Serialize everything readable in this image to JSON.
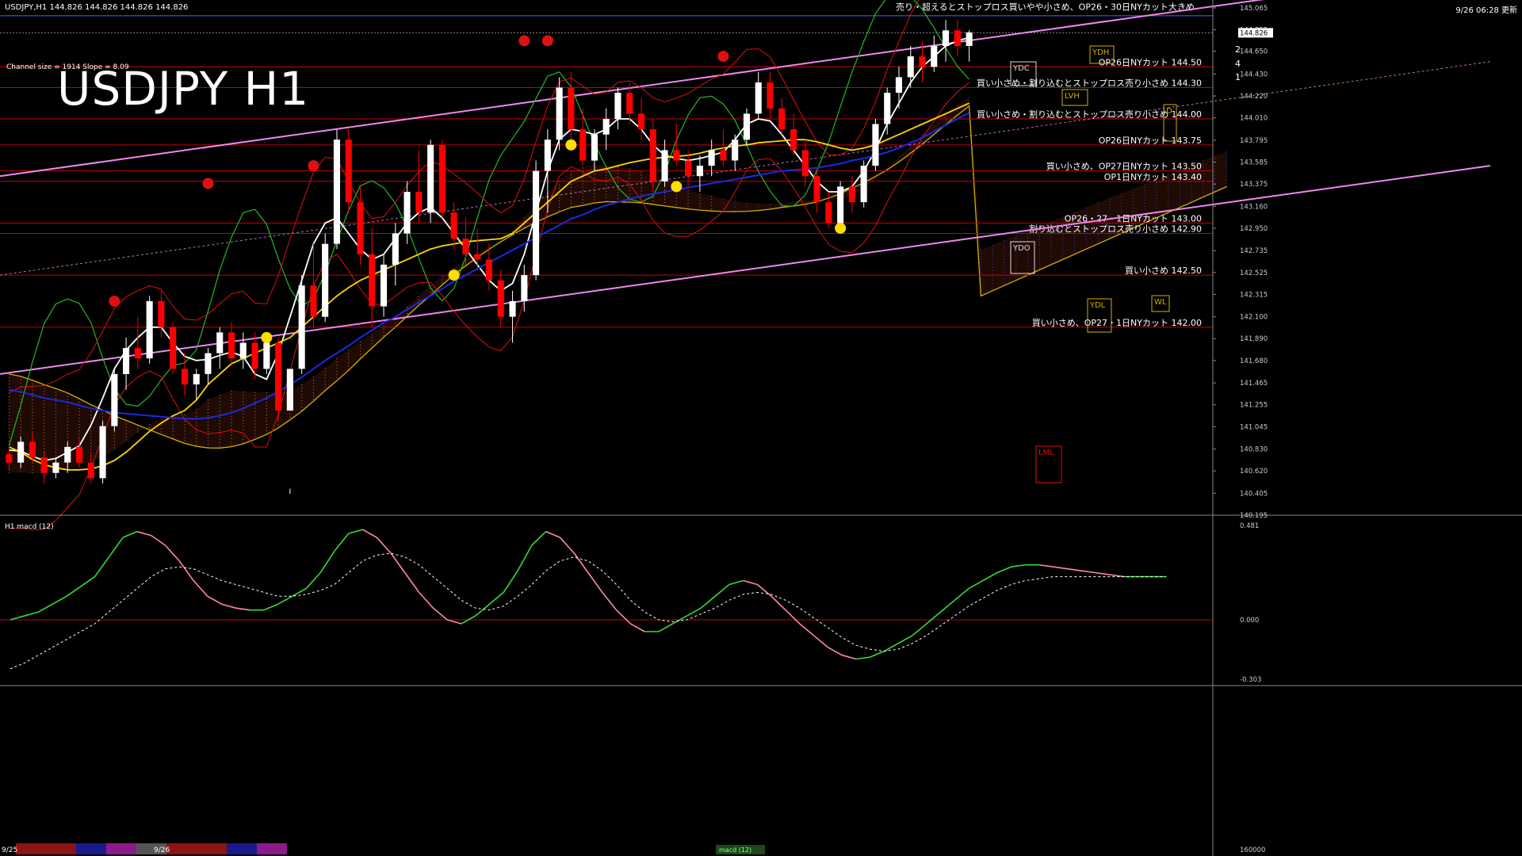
{
  "window": {
    "info": "USDJPY,H1  144.826 144.826 144.826 144.826",
    "datetime": "9/26 06:28 更新",
    "channel_info": "Channel size = 1914 Slope = 8.09",
    "title_overlay": "USDJPY H1"
  },
  "colors": {
    "background": "#000000",
    "bull_candle": "#ffffff",
    "bear_candle": "#ff0000",
    "level_line": "#c80000",
    "channel": "#ee88ee",
    "ma_fast": "#ffffff",
    "ma_mid": "#ffd700",
    "ma_slow": "#1a2adf",
    "chikou": "#22bb22",
    "bollinger": "#dd1111",
    "cloud_bear": "#ffa060",
    "cloud_bull": "#3355ff",
    "senkou_b": "#d4b000",
    "macd_up": "#33dd33",
    "macd_down": "#ff88aa",
    "signal": "#ffffff"
  },
  "chart_data": [
    {
      "type": "candlestick",
      "symbol": "USDJPY",
      "timeframe": "H1",
      "ylim": [
        140.195,
        145.065
      ],
      "price_ticks": [
        145.065,
        144.855,
        144.65,
        144.43,
        144.22,
        144.01,
        143.795,
        143.585,
        143.375,
        143.16,
        142.95,
        142.735,
        142.525,
        142.315,
        142.1,
        141.89,
        141.68,
        141.465,
        141.255,
        141.045,
        140.83,
        140.62,
        140.405,
        140.195
      ],
      "current_price": 144.826,
      "x_labels": [
        "9/25",
        "9/26"
      ],
      "ohlc": [
        [
          140.78,
          140.85,
          140.62,
          140.7
        ],
        [
          140.7,
          140.95,
          140.65,
          140.9
        ],
        [
          140.9,
          141.0,
          140.7,
          140.75
        ],
        [
          140.75,
          140.8,
          140.5,
          140.6
        ],
        [
          140.6,
          140.75,
          140.55,
          140.7
        ],
        [
          140.7,
          140.9,
          140.6,
          140.85
        ],
        [
          140.85,
          140.95,
          140.65,
          140.7
        ],
        [
          140.7,
          140.8,
          140.5,
          140.55
        ],
        [
          140.55,
          141.1,
          140.5,
          141.05
        ],
        [
          141.05,
          141.6,
          141.0,
          141.55
        ],
        [
          141.55,
          141.9,
          141.4,
          141.8
        ],
        [
          141.8,
          142.1,
          141.6,
          141.7
        ],
        [
          141.7,
          142.3,
          141.65,
          142.25
        ],
        [
          142.25,
          142.35,
          141.9,
          142.0
        ],
        [
          142.0,
          142.05,
          141.55,
          141.6
        ],
        [
          141.6,
          141.75,
          141.35,
          141.45
        ],
        [
          141.45,
          141.6,
          141.3,
          141.55
        ],
        [
          141.55,
          141.8,
          141.45,
          141.75
        ],
        [
          141.75,
          142.0,
          141.6,
          141.95
        ],
        [
          141.95,
          142.05,
          141.65,
          141.7
        ],
        [
          141.7,
          141.95,
          141.6,
          141.85
        ],
        [
          141.85,
          141.95,
          141.5,
          141.6
        ],
        [
          141.6,
          141.9,
          141.55,
          141.85
        ],
        [
          141.85,
          141.9,
          141.1,
          141.2
        ],
        [
          141.2,
          140.45,
          140.4,
          141.6
        ],
        [
          141.6,
          142.5,
          141.55,
          142.4
        ],
        [
          142.4,
          142.8,
          142.0,
          142.1
        ],
        [
          142.1,
          142.9,
          142.05,
          142.8
        ],
        [
          142.8,
          143.9,
          142.75,
          143.8
        ],
        [
          143.8,
          143.9,
          143.1,
          143.2
        ],
        [
          143.2,
          143.35,
          142.6,
          142.7
        ],
        [
          142.7,
          142.95,
          142.0,
          142.2
        ],
        [
          142.2,
          142.7,
          142.1,
          142.6
        ],
        [
          142.6,
          143.0,
          142.4,
          142.9
        ],
        [
          142.9,
          143.4,
          142.8,
          143.3
        ],
        [
          143.3,
          143.7,
          143.0,
          143.1
        ],
        [
          143.1,
          143.8,
          143.0,
          143.75
        ],
        [
          143.75,
          143.8,
          143.05,
          143.1
        ],
        [
          143.1,
          143.2,
          142.75,
          142.85
        ],
        [
          142.85,
          143.05,
          142.6,
          142.7
        ],
        [
          142.7,
          142.95,
          142.55,
          142.65
        ],
        [
          142.65,
          142.8,
          142.35,
          142.45
        ],
        [
          142.45,
          142.55,
          142.0,
          142.1
        ],
        [
          142.1,
          142.35,
          141.85,
          142.25
        ],
        [
          142.25,
          142.6,
          142.15,
          142.5
        ],
        [
          142.5,
          143.6,
          142.45,
          143.5
        ],
        [
          143.5,
          143.9,
          143.1,
          143.8
        ],
        [
          143.8,
          144.4,
          143.7,
          144.3
        ],
        [
          144.3,
          144.45,
          143.8,
          143.9
        ],
        [
          143.9,
          144.1,
          143.55,
          143.6
        ],
        [
          143.6,
          143.9,
          143.5,
          143.85
        ],
        [
          143.85,
          144.1,
          143.7,
          144.0
        ],
        [
          144.0,
          144.3,
          143.9,
          144.25
        ],
        [
          144.25,
          144.35,
          143.95,
          144.05
        ],
        [
          144.05,
          144.2,
          143.8,
          143.9
        ],
        [
          143.9,
          144.0,
          143.3,
          143.4
        ],
        [
          143.4,
          143.8,
          143.35,
          143.7
        ],
        [
          143.7,
          143.95,
          143.55,
          143.6
        ],
        [
          143.6,
          143.7,
          143.35,
          143.45
        ],
        [
          143.45,
          143.65,
          143.3,
          143.55
        ],
        [
          143.55,
          143.8,
          143.45,
          143.7
        ],
        [
          143.7,
          143.9,
          143.55,
          143.6
        ],
        [
          143.6,
          143.85,
          143.5,
          143.8
        ],
        [
          143.8,
          144.1,
          143.75,
          144.05
        ],
        [
          144.05,
          144.45,
          144.0,
          144.35
        ],
        [
          144.35,
          144.45,
          144.0,
          144.1
        ],
        [
          144.1,
          144.2,
          143.85,
          143.9
        ],
        [
          143.9,
          144.05,
          143.65,
          143.7
        ],
        [
          143.7,
          143.8,
          143.35,
          143.45
        ],
        [
          143.45,
          143.5,
          143.1,
          143.2
        ],
        [
          143.2,
          143.3,
          142.95,
          143.0
        ],
        [
          143.0,
          143.4,
          142.95,
          143.35
        ],
        [
          143.35,
          143.45,
          143.1,
          143.2
        ],
        [
          143.2,
          143.6,
          143.15,
          143.55
        ],
        [
          143.55,
          144.0,
          143.5,
          143.95
        ],
        [
          143.95,
          144.3,
          143.85,
          144.25
        ],
        [
          144.25,
          144.5,
          144.1,
          144.4
        ],
        [
          144.4,
          144.7,
          144.3,
          144.6
        ],
        [
          144.6,
          144.75,
          144.35,
          144.5
        ],
        [
          144.5,
          144.8,
          144.45,
          144.7
        ],
        [
          144.7,
          144.95,
          144.55,
          144.85
        ],
        [
          144.85,
          144.95,
          144.6,
          144.7
        ],
        [
          144.7,
          144.85,
          144.55,
          144.83
        ]
      ],
      "series": [
        {
          "name": "",
          "values": [
            140.82,
            140.81,
            140.76,
            140.72,
            140.74,
            140.8,
            140.86,
            141.06,
            141.32,
            141.6,
            141.78,
            141.9,
            142.0,
            142.0,
            141.85,
            141.72,
            141.68,
            141.69,
            141.73,
            141.76,
            141.72,
            141.55,
            141.5,
            141.75,
            142.1,
            142.45,
            142.8,
            143.0,
            143.05,
            142.9,
            142.75,
            142.65,
            142.7,
            142.85,
            143.0,
            143.1,
            143.15,
            143.05,
            142.9,
            142.75,
            142.6,
            142.45,
            142.35,
            142.42,
            142.7,
            143.1,
            143.5,
            143.8,
            143.9,
            143.88,
            143.85,
            143.9,
            144.0,
            144.0,
            143.9,
            143.75,
            143.65,
            143.62,
            143.6,
            143.62,
            143.65,
            143.68,
            143.8,
            143.95,
            144.0,
            143.98,
            143.85,
            143.7,
            143.55,
            143.4,
            143.3,
            143.3,
            143.35,
            143.5,
            143.7,
            143.95,
            144.15,
            144.35,
            144.5,
            144.6,
            144.7,
            144.75,
            144.78
          ]
        },
        {
          "name": "",
          "values": [
            140.85,
            140.8,
            140.73,
            140.68,
            140.65,
            140.63,
            140.63,
            140.64,
            140.67,
            140.72,
            140.8,
            140.9,
            141.0,
            141.08,
            141.15,
            141.2,
            141.3,
            141.45,
            141.55,
            141.65,
            141.7,
            141.75,
            141.8,
            141.85,
            141.9,
            142.0,
            142.1,
            142.2,
            142.3,
            142.38,
            142.45,
            142.5,
            142.55,
            142.6,
            142.65,
            142.7,
            142.75,
            142.78,
            142.8,
            142.82,
            142.83,
            142.84,
            142.85,
            142.9,
            143.0,
            143.1,
            143.2,
            143.3,
            143.4,
            143.45,
            143.5,
            143.52,
            143.55,
            143.58,
            143.6,
            143.62,
            143.63,
            143.64,
            143.65,
            143.67,
            143.7,
            143.72,
            143.74,
            143.75,
            143.77,
            143.78,
            143.79,
            143.8,
            143.8,
            143.78,
            143.75,
            143.72,
            143.7,
            143.72,
            143.75,
            143.8,
            143.85,
            143.9,
            143.95,
            144.0,
            144.05,
            144.1,
            144.15
          ]
        },
        {
          "name": "",
          "values": [
            141.4,
            141.38,
            141.35,
            141.32,
            141.3,
            141.28,
            141.25,
            141.22,
            141.2,
            141.18,
            141.17,
            141.16,
            141.15,
            141.14,
            141.13,
            141.12,
            141.12,
            141.13,
            141.15,
            141.18,
            141.22,
            141.27,
            141.32,
            141.38,
            141.45,
            141.52,
            141.6,
            141.68,
            141.75,
            141.82,
            141.9,
            141.97,
            142.04,
            142.1,
            142.17,
            142.24,
            142.3,
            142.37,
            142.44,
            142.5,
            142.56,
            142.62,
            142.68,
            142.74,
            142.8,
            142.86,
            142.92,
            142.98,
            143.04,
            143.08,
            143.13,
            143.17,
            143.2,
            143.23,
            143.26,
            143.28,
            143.3,
            143.32,
            143.34,
            143.36,
            143.38,
            143.4,
            143.42,
            143.44,
            143.46,
            143.48,
            143.5,
            143.51,
            143.52,
            143.53,
            143.55,
            143.57,
            143.6,
            143.62,
            143.65,
            143.68,
            143.72,
            143.77,
            143.82,
            143.88,
            143.94,
            144.0,
            144.06
          ]
        }
      ]
    },
    {
      "type": "line",
      "name": "H1  macd (12)",
      "ylim": [
        -0.303,
        0.481
      ],
      "y_ticks": [
        0.481,
        0.0,
        -0.303
      ],
      "series": [
        {
          "name": "macd",
          "values": [
            0.0,
            0.02,
            0.04,
            0.08,
            0.12,
            0.17,
            0.22,
            0.32,
            0.42,
            0.45,
            0.43,
            0.38,
            0.3,
            0.2,
            0.12,
            0.08,
            0.06,
            0.05,
            0.05,
            0.08,
            0.12,
            0.16,
            0.24,
            0.35,
            0.44,
            0.46,
            0.42,
            0.34,
            0.24,
            0.14,
            0.06,
            0.0,
            -0.02,
            0.02,
            0.08,
            0.14,
            0.25,
            0.38,
            0.45,
            0.42,
            0.34,
            0.24,
            0.14,
            0.05,
            -0.02,
            -0.06,
            -0.06,
            -0.02,
            0.02,
            0.06,
            0.12,
            0.18,
            0.2,
            0.18,
            0.12,
            0.05,
            -0.02,
            -0.08,
            -0.14,
            -0.18,
            -0.2,
            -0.19,
            -0.16,
            -0.12,
            -0.08,
            -0.02,
            0.04,
            0.1,
            0.16,
            0.2,
            0.24,
            0.27,
            0.28,
            0.28,
            0.27,
            0.26,
            0.25,
            0.24,
            0.23,
            0.22,
            0.22,
            0.22,
            0.22
          ]
        },
        {
          "name": "signal",
          "values": [
            -0.25,
            -0.22,
            -0.18,
            -0.14,
            -0.1,
            -0.06,
            -0.02,
            0.04,
            0.1,
            0.16,
            0.22,
            0.26,
            0.27,
            0.26,
            0.23,
            0.2,
            0.18,
            0.16,
            0.14,
            0.12,
            0.12,
            0.13,
            0.15,
            0.18,
            0.24,
            0.3,
            0.33,
            0.34,
            0.32,
            0.28,
            0.22,
            0.16,
            0.1,
            0.06,
            0.05,
            0.07,
            0.12,
            0.18,
            0.25,
            0.3,
            0.32,
            0.3,
            0.25,
            0.18,
            0.1,
            0.04,
            0.0,
            -0.01,
            0.0,
            0.03,
            0.06,
            0.1,
            0.13,
            0.14,
            0.13,
            0.1,
            0.06,
            0.01,
            -0.04,
            -0.09,
            -0.13,
            -0.15,
            -0.16,
            -0.15,
            -0.12,
            -0.08,
            -0.03,
            0.02,
            0.07,
            0.11,
            0.15,
            0.18,
            0.2,
            0.21,
            0.22,
            0.22,
            0.22,
            0.22,
            0.22,
            0.22,
            0.22,
            0.22,
            0.22
          ]
        }
      ]
    }
  ],
  "levels": [
    {
      "price": 144.5,
      "label": "OP26日NYカット 144.50"
    },
    {
      "price": 144.3,
      "label": "買い小さめ・割り込むとストップロス売り小さめ 144.30"
    },
    {
      "price": 144.0,
      "label": "買い小さめ・割り込むとストップロス売り小さめ 144.00"
    },
    {
      "price": 143.75,
      "label": "OP26日NYカット 143.75"
    },
    {
      "price": 143.5,
      "label": "買い小さめ、OP27日NYカット 143.50"
    },
    {
      "price": 143.4,
      "label": "OP1日NYカット 143.40"
    },
    {
      "price": 143.0,
      "label": "OP26・27・1日NYカット 143.00"
    },
    {
      "price": 142.9,
      "label": "割り込むとストップロス売り小さめ 142.90"
    },
    {
      "price": 142.5,
      "label": "買い小さめ 142.50"
    },
    {
      "price": 142.0,
      "label": "買い小さめ、OP27・1日NYカット 142.00"
    }
  ],
  "top_annotation": "売り・超えるとストップロス買いやや小さめ、OP26・30日NYカット大きめ",
  "tags": {
    "ydh": "YDH",
    "ydc_top": "YDC",
    "ydo": "YDO",
    "ydl": "YDL",
    "lvh": "LVH",
    "lml": "LML",
    "d_box": "D",
    "wl": "WL",
    "fib_2": "2",
    "fib_4": "4",
    "fib_1": "1"
  },
  "bottom_bar": {
    "left_label": "9/25",
    "mid_label": "9/26",
    "right_label": "160000",
    "center_label": "macd (12)"
  }
}
